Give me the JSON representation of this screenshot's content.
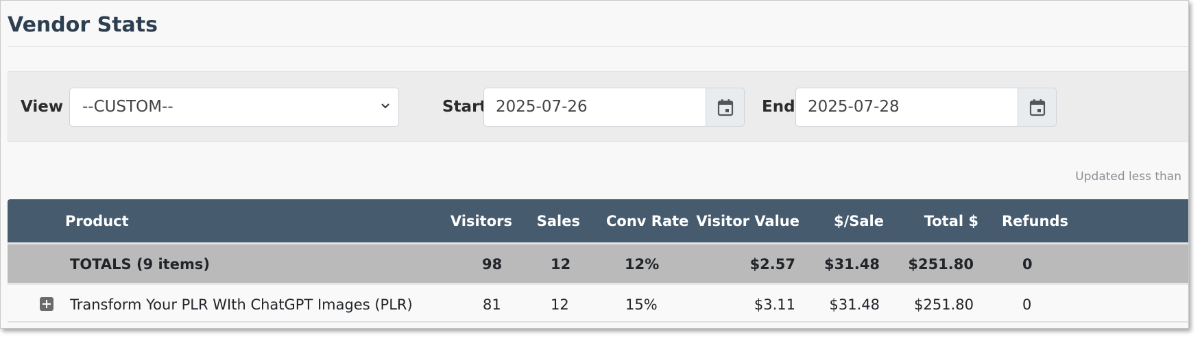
{
  "page": {
    "title": "Vendor Stats",
    "updated_text": "Updated less than"
  },
  "filters": {
    "view_label": "View",
    "view_selected": "--CUSTOM--",
    "start_label": "Start",
    "start_value": "2025-07-26",
    "end_label": "End",
    "end_value": "2025-07-28",
    "calendar_icon": "calendar-icon",
    "dropdown_icon": "chevron-down-icon"
  },
  "table": {
    "headers": {
      "product": "Product",
      "visitors": "Visitors",
      "sales": "Sales",
      "conv_rate": "Conv Rate",
      "visitor_value": "Visitor Value",
      "per_sale": "$/Sale",
      "total": "Total $",
      "refunds": "Refunds"
    },
    "totals": {
      "label": "TOTALS (9 items)",
      "visitors": "98",
      "sales": "12",
      "conv_rate": "12%",
      "visitor_value": "$2.57",
      "per_sale": "$31.48",
      "total": "$251.80",
      "refunds": "0"
    },
    "rows": [
      {
        "product": "Transform Your PLR WIth ChatGPT Images (PLR)",
        "visitors": "81",
        "sales": "12",
        "conv_rate": "15%",
        "visitor_value": "$3.11",
        "per_sale": "$31.48",
        "total": "$251.80",
        "refunds": "0"
      }
    ]
  },
  "colors": {
    "header_bg": "#475b6e",
    "totals_bg": "#bababa",
    "title": "#2d3e50"
  }
}
